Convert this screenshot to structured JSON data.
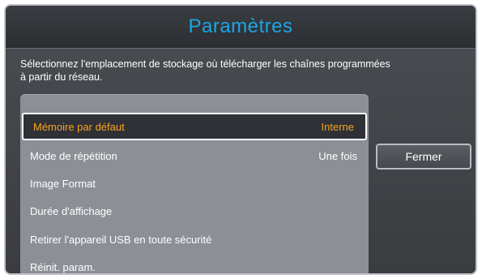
{
  "dialog": {
    "title": "Paramètres",
    "description": "Sélectionnez l'emplacement de stockage où télécharger les chaînes programmées à partir du réseau."
  },
  "menu": {
    "items": [
      {
        "label": "Mémoire par défaut",
        "value": "Interne",
        "selected": true
      },
      {
        "label": "Mode de répétition",
        "value": "Une fois",
        "selected": false
      },
      {
        "label": "Image Format",
        "value": "",
        "selected": false
      },
      {
        "label": "Durée d'affichage",
        "value": "",
        "selected": false
      },
      {
        "label": "Retirer l'appareil USB en toute sécurité",
        "value": "",
        "selected": false
      },
      {
        "label": "Réinit. param.",
        "value": "",
        "selected": false
      }
    ]
  },
  "buttons": {
    "close_label": "Fermer"
  },
  "colors": {
    "title": "#1aa6e6",
    "selected_text": "#f6a41f",
    "panel": "#8c9096"
  }
}
